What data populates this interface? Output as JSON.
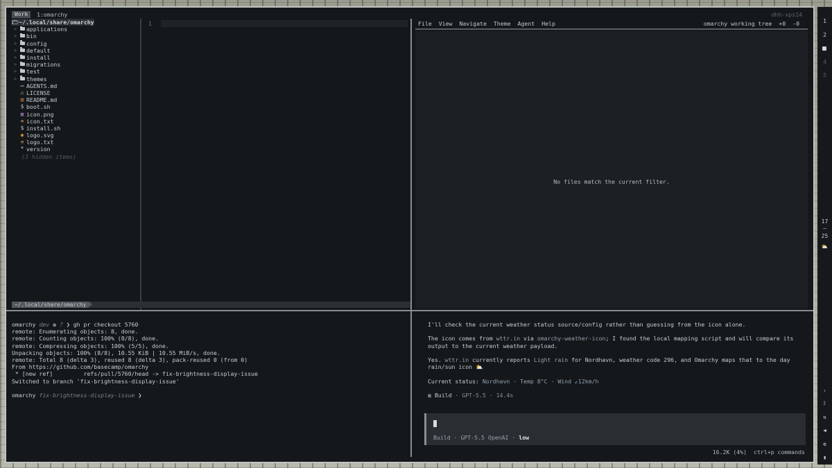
{
  "topbar": {
    "workspace_tab": "Work",
    "workspace_name": "1:omarchy",
    "host": "dhh-xps14"
  },
  "tree": {
    "root": "~/.local/share/omarchy",
    "items": [
      {
        "label": "applications",
        "type": "folder"
      },
      {
        "label": "bin",
        "type": "folder"
      },
      {
        "label": "config",
        "type": "folder"
      },
      {
        "label": "default",
        "type": "folder"
      },
      {
        "label": "install",
        "type": "folder"
      },
      {
        "label": "migrations",
        "type": "folder"
      },
      {
        "label": "test",
        "type": "folder"
      },
      {
        "label": "themes",
        "type": "folder"
      },
      {
        "label": "AGENTS.md",
        "type": "md",
        "icon": "▭",
        "color": "#c8ccd0"
      },
      {
        "label": "LICENSE",
        "type": "license",
        "icon": "⚖",
        "color": "#6fb08a"
      },
      {
        "label": "README.md",
        "type": "readme",
        "icon": "▤",
        "color": "#d9823b"
      },
      {
        "label": "boot.sh",
        "type": "sh",
        "icon": "$",
        "color": "#c8ccd0"
      },
      {
        "label": "icon.png",
        "type": "png",
        "icon": "▦",
        "color": "#a27ac0"
      },
      {
        "label": "icon.txt",
        "type": "txt",
        "icon": "≡",
        "color": "#c08a5a"
      },
      {
        "label": "install.sh",
        "type": "sh",
        "icon": "$",
        "color": "#c8ccd0"
      },
      {
        "label": "logo.svg",
        "type": "svg",
        "icon": "◉",
        "color": "#d9a03b"
      },
      {
        "label": "logo.txt",
        "type": "txt",
        "icon": "≡",
        "color": "#c08a5a"
      },
      {
        "label": "version",
        "type": "file",
        "icon": "*",
        "color": "#c8ccd0"
      }
    ],
    "hidden_note": "(3 hidden items)"
  },
  "editor": {
    "line_number": "1"
  },
  "pathbar": {
    "path": "~/.local/share/omarchy"
  },
  "git": {
    "menu": [
      "File",
      "View",
      "Navigate",
      "Theme",
      "Agent",
      "Help"
    ],
    "status_label": "omarchy working tree",
    "added": "+0",
    "removed": "-0",
    "empty_message": "No files match the current filter."
  },
  "terminal": {
    "prompt_user": "omarchy",
    "prompt_branch_1": "dev ● ? ",
    "prompt_arrow_1": "❯ ",
    "command": "gh pr checkout 5760",
    "output": [
      "remote: Enumerating objects: 8, done.",
      "remote: Counting objects: 100% (8/8), done.",
      "remote: Compressing objects: 100% (5/5), done.",
      "Unpacking objects: 100% (8/8), 10.55 KiB | 10.55 MiB/s, done.",
      "remote: Total 8 (delta 3), reused 8 (delta 3), pack-reused 0 (from 0)",
      "From https://github.com/basecamp/omarchy",
      " * [new ref]         refs/pull/5760/head -> fix-brightness-display-issue",
      "Switched to branch 'fix-brightness-display-issue'"
    ],
    "prompt_branch_2": "fix-brightness-display-issue ",
    "prompt_arrow_2": "❯"
  },
  "agent": {
    "msg1": "I'll check the current weather status source/config rather than guessing from the icon alone.",
    "msg2_a": "The icon comes from ",
    "msg2_link1": "wttr.in",
    "msg2_b": " via ",
    "msg2_link2": "omarchy-weather-icon",
    "msg2_c": "; I found the local mapping script and will compare its output to the current weather payload.",
    "msg3_a": "Yes. ",
    "msg3_link1": "wttr.in",
    "msg3_b": " currently reports ",
    "msg3_link2": "Light rain",
    "msg3_c": " for Nordhavn, weather code 296, and Omarchy maps that to the day rain/sun icon ⛅",
    "status_label": "Current status: ",
    "status_value": "Nordhavn · Temp 8°C · Wind ↙12km/h",
    "build_icon": "▣",
    "build_label": "Build",
    "build_model": " · GPT-5.5 · 14.4s",
    "input_build": "Build",
    "input_model": " · GPT-5.5 ",
    "input_provider": "OpenAI",
    "input_sep": " · ",
    "input_effort": "low",
    "tokens": "16.2K (4%)",
    "commands_hint": "ctrl+p commands"
  },
  "sidebar": {
    "workspaces": [
      "1",
      "2",
      "4",
      "5"
    ],
    "time_hour": "17",
    "time_sep": "—",
    "time_min": "25",
    "icons": [
      "weather-icon",
      "chevron-left-icon",
      "bluetooth-icon",
      "network-icon",
      "volume-icon",
      "cpu-icon",
      "battery-icon"
    ]
  }
}
